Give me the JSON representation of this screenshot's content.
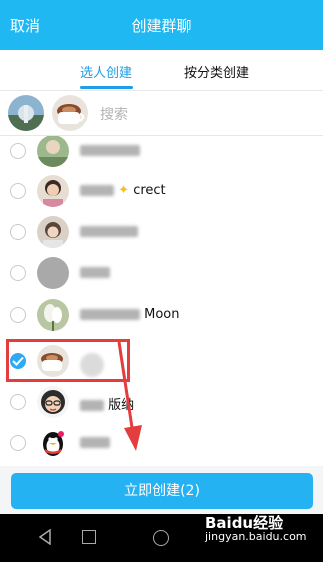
{
  "header": {
    "cancel_label": "取消",
    "title": "创建群聊"
  },
  "tabs": [
    {
      "label": "选人创建"
    },
    {
      "label": "按分类创建"
    }
  ],
  "search": {
    "placeholder": "搜索"
  },
  "contacts": [
    {
      "name": "",
      "checked": false
    },
    {
      "name": "crect",
      "checked": false
    },
    {
      "name": "",
      "checked": false
    },
    {
      "name": "",
      "checked": false
    },
    {
      "name": "Moon",
      "checked": false
    },
    {
      "name": "",
      "checked": true
    },
    {
      "name": "版纳",
      "checked": false
    },
    {
      "name": "",
      "checked": false
    }
  ],
  "create_button": {
    "label": "立即创建(2)"
  },
  "watermark": {
    "brand": "Baidu经验",
    "url": "jingyan.baidu.com"
  },
  "colors": {
    "accent": "#1fb8f3",
    "highlight": "#e33d3d",
    "button": "#24b2f2"
  }
}
